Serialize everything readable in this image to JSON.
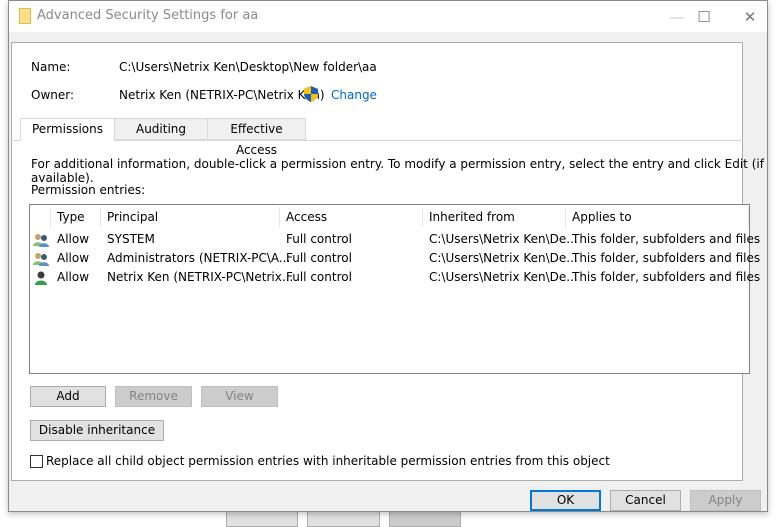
{
  "window": {
    "title": "Advanced Security Settings for aa",
    "icons": {
      "app": "folder-icon",
      "minimize": "minimize-icon",
      "maximize": "maximize-icon",
      "close": "close-icon"
    },
    "minimize_glyph": "—",
    "maximize_glyph": "☐",
    "close_glyph": "✕"
  },
  "details": {
    "name_label": "Name:",
    "name_value": "C:\\Users\\Netrix Ken\\Desktop\\New folder\\aa",
    "owner_label": "Owner:",
    "owner_value": "Netrix Ken (NETRIX-PC\\Netrix Ken)",
    "change_label": "Change",
    "change_icon": "uac-shield-icon"
  },
  "tabs": [
    {
      "label": "Permissions",
      "active": true
    },
    {
      "label": "Auditing",
      "active": false
    },
    {
      "label": "Effective Access",
      "active": false
    }
  ],
  "permissions": {
    "info_text": "For additional information, double-click a permission entry. To modify a permission entry, select the entry and click Edit (if available).",
    "entries_label": "Permission entries:",
    "columns": [
      "Type",
      "Principal",
      "Access",
      "Inherited from",
      "Applies to"
    ],
    "rows": [
      {
        "icon": "group-users-icon",
        "type": "Allow",
        "principal": "SYSTEM",
        "access": "Full control",
        "inherited_from": "C:\\Users\\Netrix Ken\\De...",
        "applies_to": "This folder, subfolders and files"
      },
      {
        "icon": "group-users-icon",
        "type": "Allow",
        "principal": "Administrators (NETRIX-PC\\A...",
        "access": "Full control",
        "inherited_from": "C:\\Users\\Netrix Ken\\De...",
        "applies_to": "This folder, subfolders and files"
      },
      {
        "icon": "user-icon",
        "type": "Allow",
        "principal": "Netrix Ken (NETRIX-PC\\Netrix...",
        "access": "Full control",
        "inherited_from": "C:\\Users\\Netrix Ken\\De...",
        "applies_to": "This folder, subfolders and files"
      }
    ],
    "add_label": "Add",
    "remove_label": "Remove",
    "view_label": "View",
    "disable_inheritance_label": "Disable inheritance",
    "replace_checkbox_label": "Replace all child object permission entries with inheritable permission entries from this object",
    "replace_checked": false
  },
  "footer": {
    "ok_label": "OK",
    "cancel_label": "Cancel",
    "apply_label": "Apply"
  }
}
